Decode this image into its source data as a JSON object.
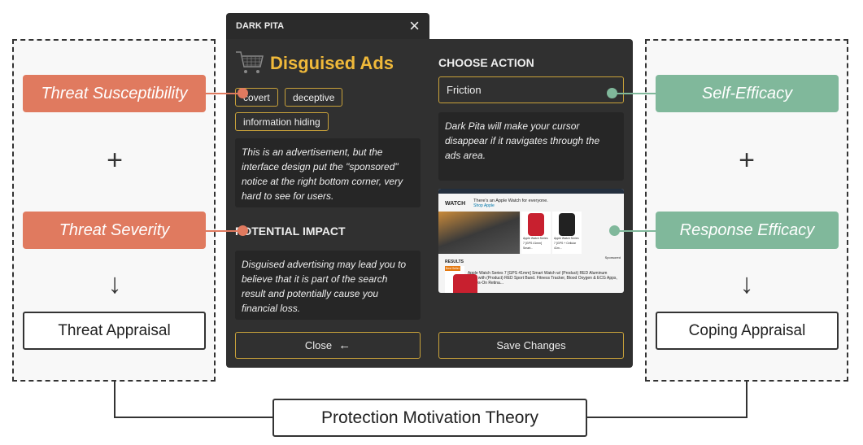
{
  "threat": {
    "susceptibility": "Threat Susceptibility",
    "plus": "+",
    "severity": "Threat Severity",
    "arrow": "↓",
    "appraisal": "Threat Appraisal"
  },
  "coping": {
    "self_efficacy": "Self-Efficacy",
    "plus": "+",
    "response_efficacy": "Response Efficacy",
    "arrow": "↓",
    "appraisal": "Coping Appraisal"
  },
  "theory": "Protection Motivation Theory",
  "colors": {
    "threat": "#e07a5f",
    "coping": "#80b89b",
    "accent": "#f0b93a"
  },
  "app": {
    "tab_title": "DARK PITA",
    "close_icon": "×",
    "pattern_title": "Disguised Ads",
    "tags": [
      "covert",
      "deceptive",
      "information hiding"
    ],
    "description": "This is an advertisement, but the interface design put the \"sponsored\" notice at the right bottom corner, very hard to see for users.",
    "impact_heading": "POTENTIAL IMPACT",
    "impact_text": "Disguised advertising may lead you to believe that it is part of the search result and potentially cause you financial loss.",
    "close_label": "Close",
    "choose_heading": "CHOOSE ACTION",
    "action_selected": "Friction",
    "action_description": "Dark Pita will make your cursor disappear if it navigates through the ads area.",
    "save_label": "Save Changes",
    "preview": {
      "brand": "WATCH",
      "headline": "There's an Apple Watch for everyone.",
      "shop": "Shop Apple",
      "product1": "Apple Watch Series 7 [GPS 41mm] Smart...",
      "product2": "Apple Watch Series 7 [GPS + Cellular 41m...",
      "sponsored": "Sponsored",
      "results": "RESULTS",
      "best_seller": "Best Seller",
      "result_title": "Apple Watch Series 7 [GPS 41mm] Smart Watch w/ (Product) RED Aluminum Case with (Product) RED Sport Band. Fitness Tracker, Blood Oxygen & ECG Apps, Always-On Retina..."
    }
  }
}
